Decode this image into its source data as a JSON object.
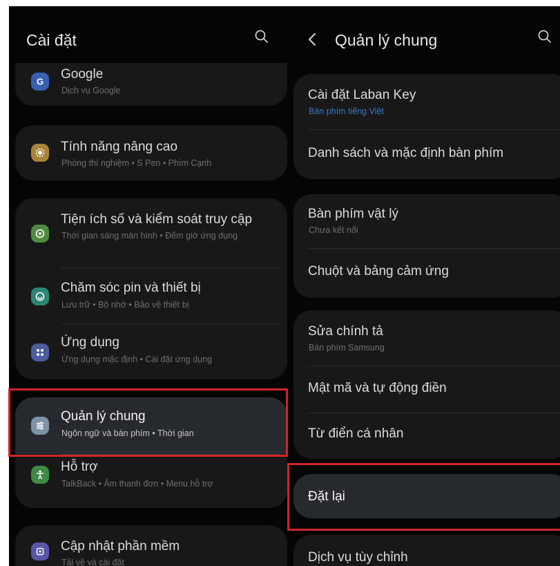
{
  "left": {
    "title": "Cài đặt",
    "items": [
      {
        "title": "Google",
        "subtitle": "Dịch vụ Google",
        "icon": "google-icon",
        "color": "#3a5fb0"
      },
      {
        "title": "Tính năng nâng cao",
        "subtitle": "Phòng thí nghiệm • S Pen • Phím Cạnh",
        "icon": "advanced-features-icon",
        "color": "#a8843a"
      },
      {
        "title": "Tiện ích số và kiểm soát truy cập",
        "subtitle": "Thời gian sáng màn hình • Đếm giờ ứng dụng",
        "icon": "digital-wellbeing-icon",
        "color": "#4f8a3e"
      },
      {
        "title": "Chăm sóc pin và thiết bị",
        "subtitle": "Lưu trữ • Bộ nhớ • Bảo vệ thiết bị",
        "icon": "device-care-icon",
        "color": "#2f8575"
      },
      {
        "title": "Ứng dụng",
        "subtitle": "Ứng dụng mặc định • Cài đặt ứng dụng",
        "icon": "apps-icon",
        "color": "#4c5c9c"
      },
      {
        "title": "Quản lý chung",
        "subtitle": "Ngôn ngữ và bàn phím • Thời gian",
        "icon": "general-management-icon",
        "color": "#7d93a6"
      },
      {
        "title": "Hỗ trợ",
        "subtitle": "TalkBack • Âm thanh đơn • Menu hỗ trợ",
        "icon": "accessibility-icon",
        "color": "#3f8a45"
      },
      {
        "title": "Cập nhật phần mềm",
        "subtitle": "Tải về và cài đặt",
        "icon": "software-update-icon",
        "color": "#5a56a6"
      }
    ]
  },
  "right": {
    "title": "Quản lý chung",
    "items": [
      {
        "title": "Cài đặt Laban Key",
        "subtitle": "Bàn phím tiếng Việt"
      },
      {
        "title": "Danh sách và mặc định bàn phím"
      },
      {
        "title": "Bàn phím vật lý",
        "subtitle": "Chưa kết nối"
      },
      {
        "title": "Chuột và bảng cảm ứng"
      },
      {
        "title": "Sửa chính tả",
        "subtitle": "Bàn phím Samsung"
      },
      {
        "title": "Mật mã và tự động điền"
      },
      {
        "title": "Từ điển cá nhân"
      },
      {
        "title": "Đặt lại"
      },
      {
        "title": "Dịch vụ tùy chỉnh"
      }
    ]
  },
  "colors": {
    "background": "#050505",
    "card": "#181818",
    "highlight": "#262a2e",
    "annotation": "#d0242b",
    "link": "#3d78c9"
  }
}
